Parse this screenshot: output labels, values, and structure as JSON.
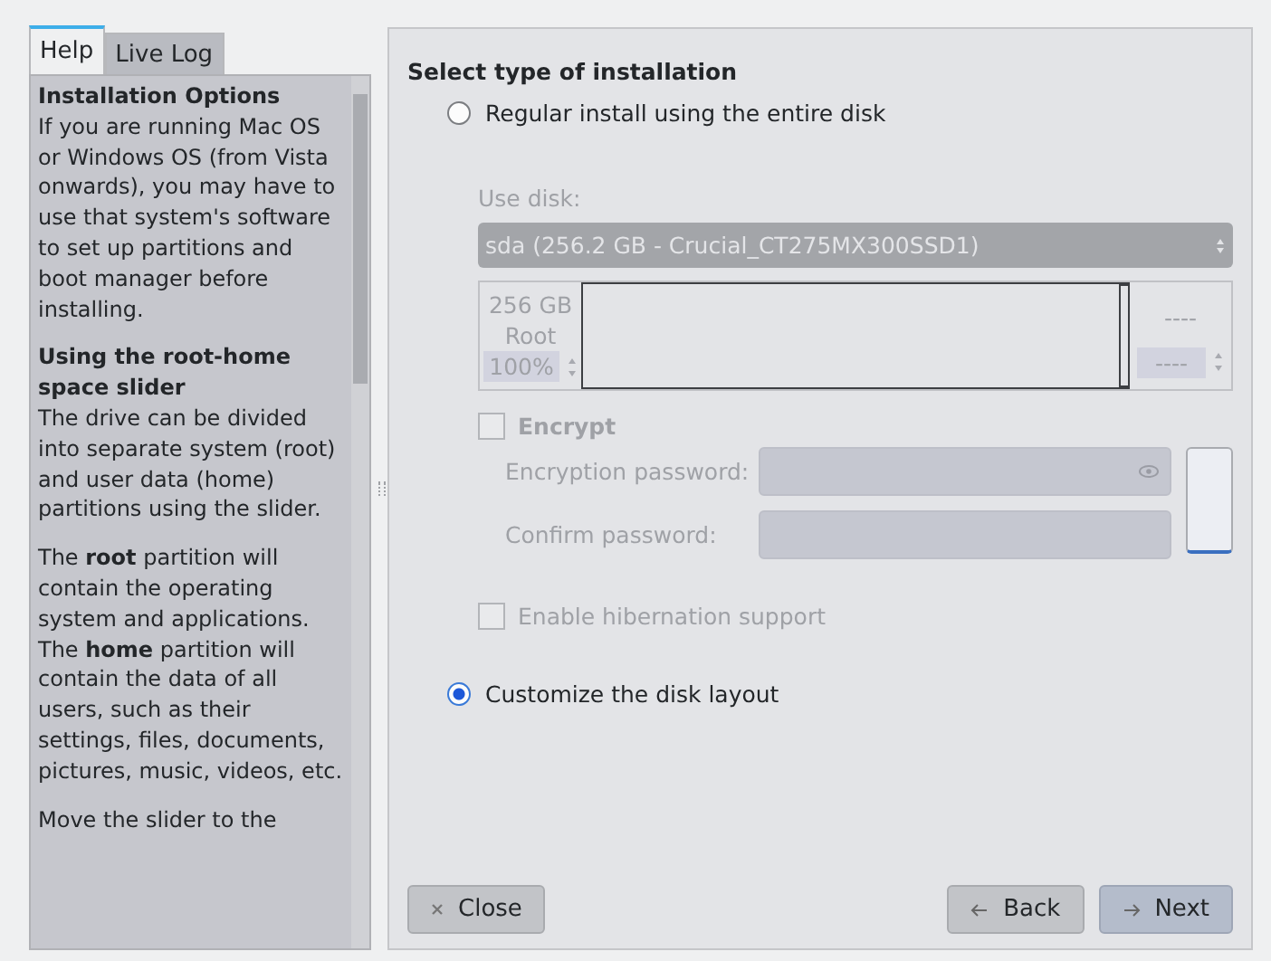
{
  "tabs": [
    {
      "label": "Help",
      "selected": true
    },
    {
      "label": "Live Log",
      "selected": false
    }
  ],
  "help": [
    {
      "heading": "Installation Options",
      "text": "If you are running Mac OS or Windows OS (from Vista onwards), you may have to use that system's software to set up partitions and boot manager before installing."
    },
    {
      "heading": "Using the root-home space slider",
      "text": "The drive can be divided into separate system (root) and user data (home) partitions using the slider."
    },
    {
      "text": "The **root** partition will contain the operating system and applications. The **home** partition will contain the data of all users, such as their settings, files, documents, pictures, music, videos, etc."
    },
    {
      "text": "Move the slider to the"
    }
  ],
  "section_title": "Select type of installation",
  "options": [
    {
      "label": "Regular install using the entire disk",
      "selected": false
    },
    {
      "label": "Customize the disk layout",
      "selected": true
    }
  ],
  "disk": {
    "label": "Use disk:",
    "value": "sda (256.2 GB - Crucial_CT275MX300SSD1)",
    "disabled": true,
    "root": {
      "size": "256 GB",
      "name": "Root",
      "percent": "100%"
    },
    "slider": {
      "level": 1
    },
    "home": {
      "size": "----",
      "percent": "----"
    }
  },
  "encrypt": {
    "label": "Encrypt",
    "checked": false,
    "password_label": "Encryption password:",
    "confirm_label": "Confirm password:"
  },
  "hibernation": {
    "label": "Enable hibernation support",
    "checked": false
  },
  "buttons": {
    "close": "Close",
    "back": "Back",
    "next": "Next"
  }
}
